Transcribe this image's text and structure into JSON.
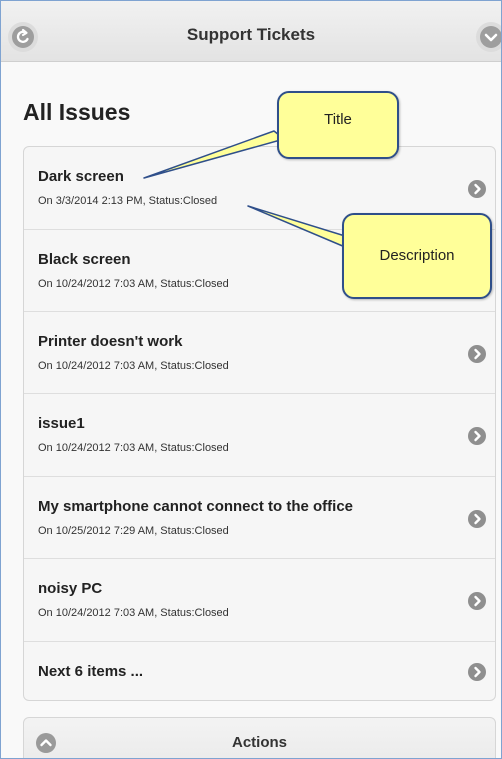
{
  "header": {
    "title": "Support Tickets",
    "back_icon": "back-arrow-icon",
    "menu_icon": "chevron-down-icon"
  },
  "page": {
    "heading": "All Issues"
  },
  "tickets": [
    {
      "title": "Dark screen",
      "description": "On 3/3/2014 2:13 PM, Status:Closed"
    },
    {
      "title": "Black screen",
      "description": "On 10/24/2012 7:03 AM, Status:Closed"
    },
    {
      "title": "Printer doesn't work",
      "description": "On 10/24/2012 7:03 AM, Status:Closed"
    },
    {
      "title": "issue1",
      "description": "On 10/24/2012 7:03 AM, Status:Closed"
    },
    {
      "title": "My smartphone cannot connect to the office",
      "description": "On 10/25/2012 7:29 AM, Status:Closed"
    },
    {
      "title": "noisy PC",
      "description": "On 10/24/2012 7:03 AM, Status:Closed"
    }
  ],
  "pager": {
    "label": "Next 6 items ..."
  },
  "actions": {
    "label": "Actions",
    "icon": "chevron-up-icon"
  },
  "annotations": {
    "title_callout": "Title",
    "description_callout": "Description",
    "fill_color": "#ffff99",
    "border_color": "#2f4f8a"
  },
  "colors": {
    "frame_border": "#7fa3d1",
    "icon_gray": "#8f8f8f"
  }
}
